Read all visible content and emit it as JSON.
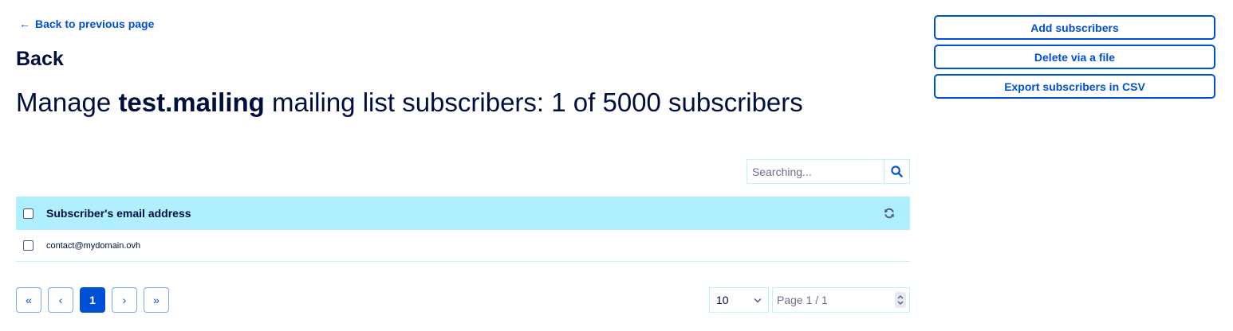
{
  "nav": {
    "back_link": "Back to previous page"
  },
  "header": {
    "back_heading": "Back",
    "title_prefix": "Manage ",
    "title_list_name": "test.mailing",
    "title_suffix": " mailing list subscribers: 1 of 5000 subscribers"
  },
  "actions": {
    "add": "Add subscribers",
    "delete_file": "Delete via a file",
    "export_csv": "Export subscribers in CSV"
  },
  "search": {
    "placeholder": "Searching..."
  },
  "table": {
    "column_header": "Subscriber's email address",
    "rows": [
      {
        "email": "contact@mydomain.ovh"
      }
    ]
  },
  "pagination": {
    "first": "«",
    "prev": "‹",
    "current": "1",
    "next": "›",
    "last": "»",
    "per_page": "10",
    "page_indicator": "Page 1 / 1"
  },
  "colors": {
    "accent": "#0050d7",
    "header_bg": "#b0efff",
    "text_dark": "#000e3f"
  },
  "icons": {
    "back": "arrow-left-icon",
    "search": "search-icon",
    "refresh": "refresh-icon",
    "dropdown": "chevron-down-icon"
  }
}
